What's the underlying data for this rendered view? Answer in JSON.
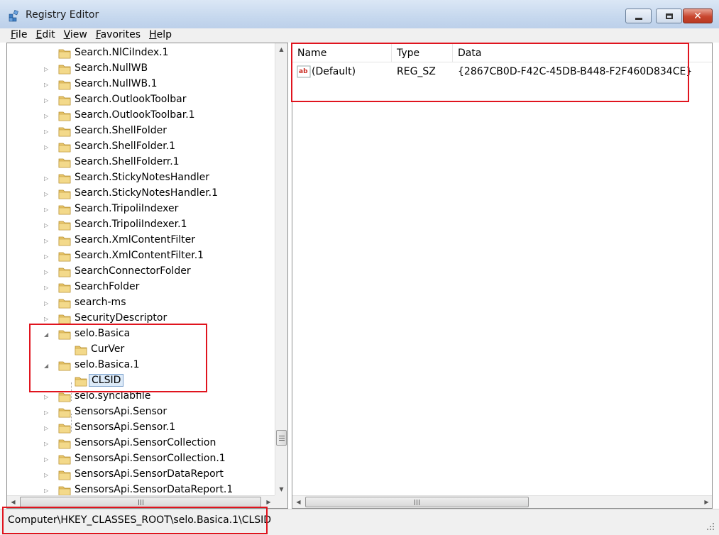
{
  "window": {
    "title": "Registry Editor",
    "close_glyph": "✕"
  },
  "menu": [
    {
      "key": "F",
      "rest": "ile"
    },
    {
      "key": "E",
      "rest": "dit"
    },
    {
      "key": "V",
      "rest": "iew"
    },
    {
      "key": "F",
      "rest": "avorites"
    },
    {
      "key": "H",
      "rest": "elp"
    }
  ],
  "tree": {
    "items": [
      {
        "label": "Search.NlCiIndex.1",
        "expander": ""
      },
      {
        "label": "Search.NullWB",
        "expander": "▷"
      },
      {
        "label": "Search.NullWB.1",
        "expander": "▷"
      },
      {
        "label": "Search.OutlookToolbar",
        "expander": "▷"
      },
      {
        "label": "Search.OutlookToolbar.1",
        "expander": "▷"
      },
      {
        "label": "Search.ShellFolder",
        "expander": "▷"
      },
      {
        "label": "Search.ShellFolder.1",
        "expander": "▷"
      },
      {
        "label": "Search.ShellFolderr.1",
        "expander": ""
      },
      {
        "label": "Search.StickyNotesHandler",
        "expander": "▷"
      },
      {
        "label": "Search.StickyNotesHandler.1",
        "expander": "▷"
      },
      {
        "label": "Search.TripoliIndexer",
        "expander": "▷"
      },
      {
        "label": "Search.TripoliIndexer.1",
        "expander": "▷"
      },
      {
        "label": "Search.XmlContentFilter",
        "expander": "▷"
      },
      {
        "label": "Search.XmlContentFilter.1",
        "expander": "▷"
      },
      {
        "label": "SearchConnectorFolder",
        "expander": "▷"
      },
      {
        "label": "SearchFolder",
        "expander": "▷"
      },
      {
        "label": "search-ms",
        "expander": "▷"
      },
      {
        "label": "SecurityDescriptor",
        "expander": "▷"
      },
      {
        "label": "selo.Basica",
        "expander": "◢"
      },
      {
        "label": "CurVer",
        "expander": ""
      },
      {
        "label": "selo.Basica.1",
        "expander": "◢"
      },
      {
        "label": "CLSID",
        "expander": ""
      },
      {
        "label": "selo.synclabfile",
        "expander": "▷"
      },
      {
        "label": "SensorsApi.Sensor",
        "expander": "▷"
      },
      {
        "label": "SensorsApi.Sensor.1",
        "expander": "▷"
      },
      {
        "label": "SensorsApi.SensorCollection",
        "expander": "▷"
      },
      {
        "label": "SensorsApi.SensorCollection.1",
        "expander": "▷"
      },
      {
        "label": "SensorsApi.SensorDataReport",
        "expander": "▷"
      },
      {
        "label": "SensorsApi.SensorDataReport.1",
        "expander": "▷"
      }
    ]
  },
  "values": {
    "columns": {
      "name": "Name",
      "type": "Type",
      "data": "Data"
    },
    "rows": [
      {
        "name": "(Default)",
        "type": "REG_SZ",
        "data": "{2867CB0D-F42C-45DB-B448-F2F460D834CE}"
      }
    ]
  },
  "status": {
    "path": "Computer\\HKEY_CLASSES_ROOT\\selo.Basica.1\\CLSID"
  },
  "scroll": {
    "tree_vertical_position": 0.87
  },
  "colors": {
    "highlight": "#e0141e",
    "selection": "#dceaf8",
    "folder": "#e8c56a"
  }
}
